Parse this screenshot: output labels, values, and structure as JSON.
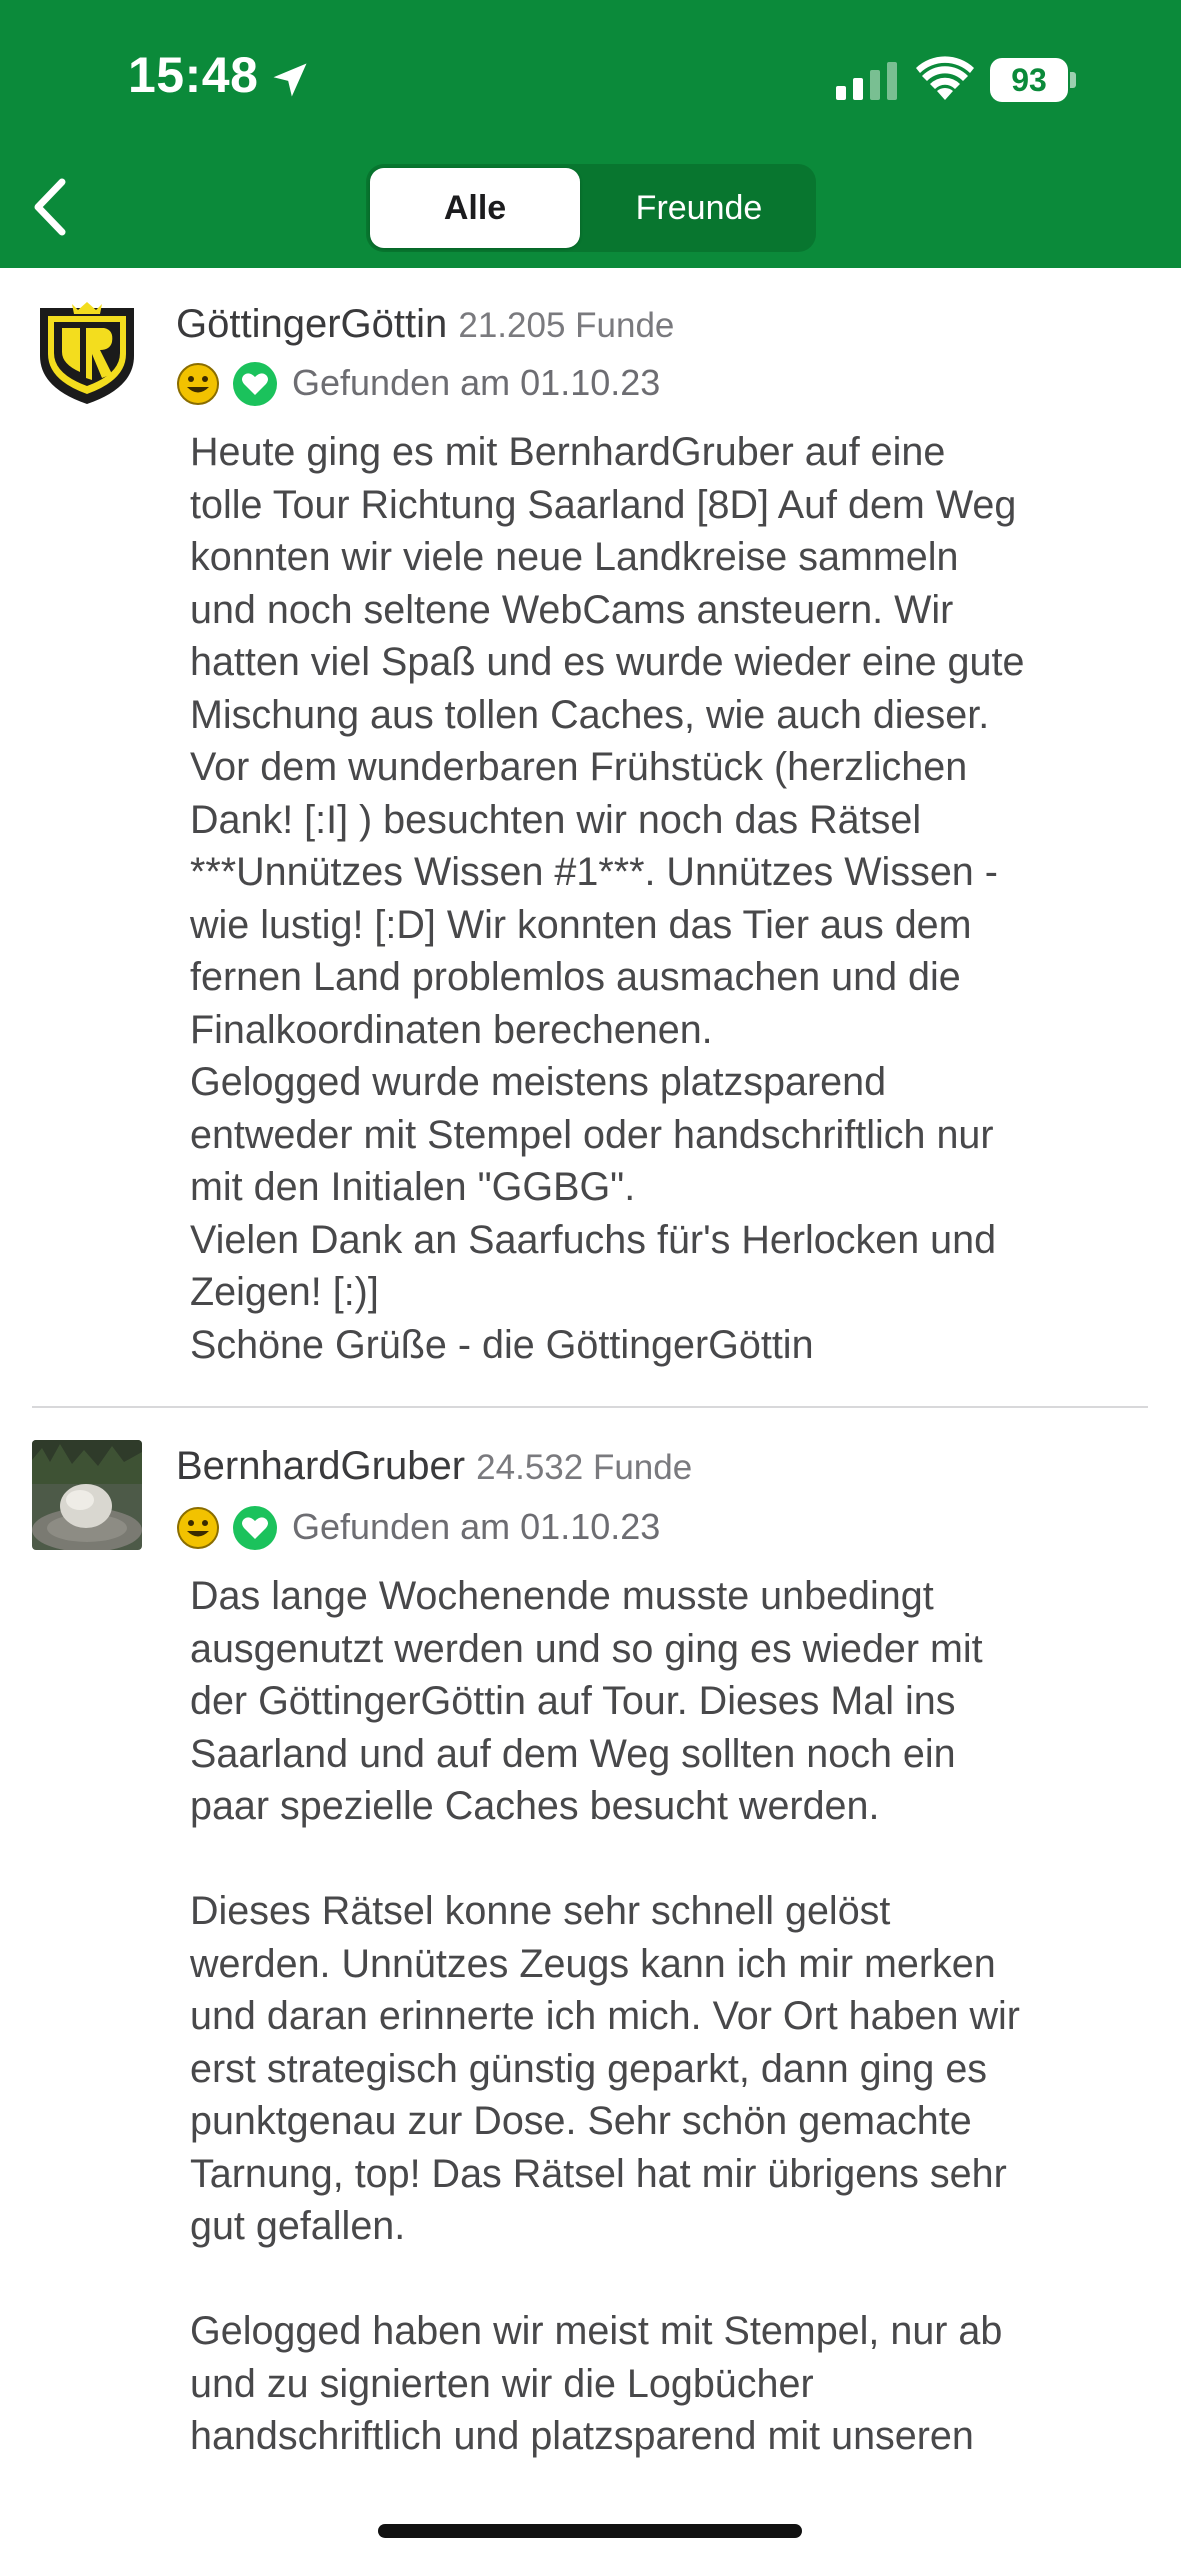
{
  "status_bar": {
    "time": "15:48",
    "battery": "93",
    "icons": [
      "location-arrow-icon",
      "cellular-signal-icon",
      "wifi-icon",
      "battery-icon"
    ]
  },
  "nav": {
    "back_icon": "chevron-left-icon",
    "tabs": [
      {
        "label": "Alle",
        "selected": true
      },
      {
        "label": "Freunde",
        "selected": false
      }
    ]
  },
  "colors": {
    "header": "#0b8a3a",
    "segment_bg": "#08762f",
    "favorite_heart": "#1bc25c",
    "smiley": "#f2c200"
  },
  "logs": [
    {
      "user": "GöttingerGöttin",
      "finds": "21.205 Funde",
      "found": "Gefunden am 01.10.23",
      "text": "Heute ging es mit BernhardGruber auf eine\ntolle Tour Richtung Saarland [8D] Auf dem Weg\nkonnten wir viele neue Landkreise sammeln\nund noch seltene WebCams ansteuern. Wir\nhatten viel Spaß und es wurde wieder eine gute\nMischung aus tollen Caches, wie auch dieser.\nVor dem wunderbaren Frühstück (herzlichen\nDank! [:I] ) besuchten wir noch das Rätsel\n***Unnützes Wissen #1***. Unnützes Wissen -\nwie lustig! [:D] Wir konnten das Tier aus dem\nfernen Land problemlos ausmachen und die\nFinalkoordinaten berechenen.\nGelogged wurde meistens platzsparend\nentweder mit Stempel oder handschriftlich nur\nmit den Initialen \"GGBG\".\nVielen Dank an Saarfuchs für's Herlocken und\nZeigen! [:)]\nSchöne Grüße - die GöttingerGöttin"
    },
    {
      "user": "BernhardGruber",
      "finds": "24.532 Funde",
      "found": "Gefunden am 01.10.23",
      "text": "Das lange Wochenende musste unbedingt\nausgenutzt werden und so ging es wieder mit\nder GöttingerGöttin auf Tour. Dieses Mal ins\nSaarland und auf dem Weg sollten noch ein\npaar spezielle Caches besucht werden.\n\nDieses Rätsel konne sehr schnell gelöst\nwerden. Unnützes Zeugs kann ich mir merken\nund daran erinnerte ich mich. Vor Ort haben wir\nerst strategisch günstig geparkt, dann ging es\npunktgenau zur Dose. Sehr schön gemachte\nTarnung, top! Das Rätsel hat mir übrigens sehr\ngut gefallen.\n\nGelogged haben wir meist mit Stempel, nur ab\nund zu signierten wir die Logbücher\nhandschriftlich und platzsparend mit unseren"
    }
  ]
}
